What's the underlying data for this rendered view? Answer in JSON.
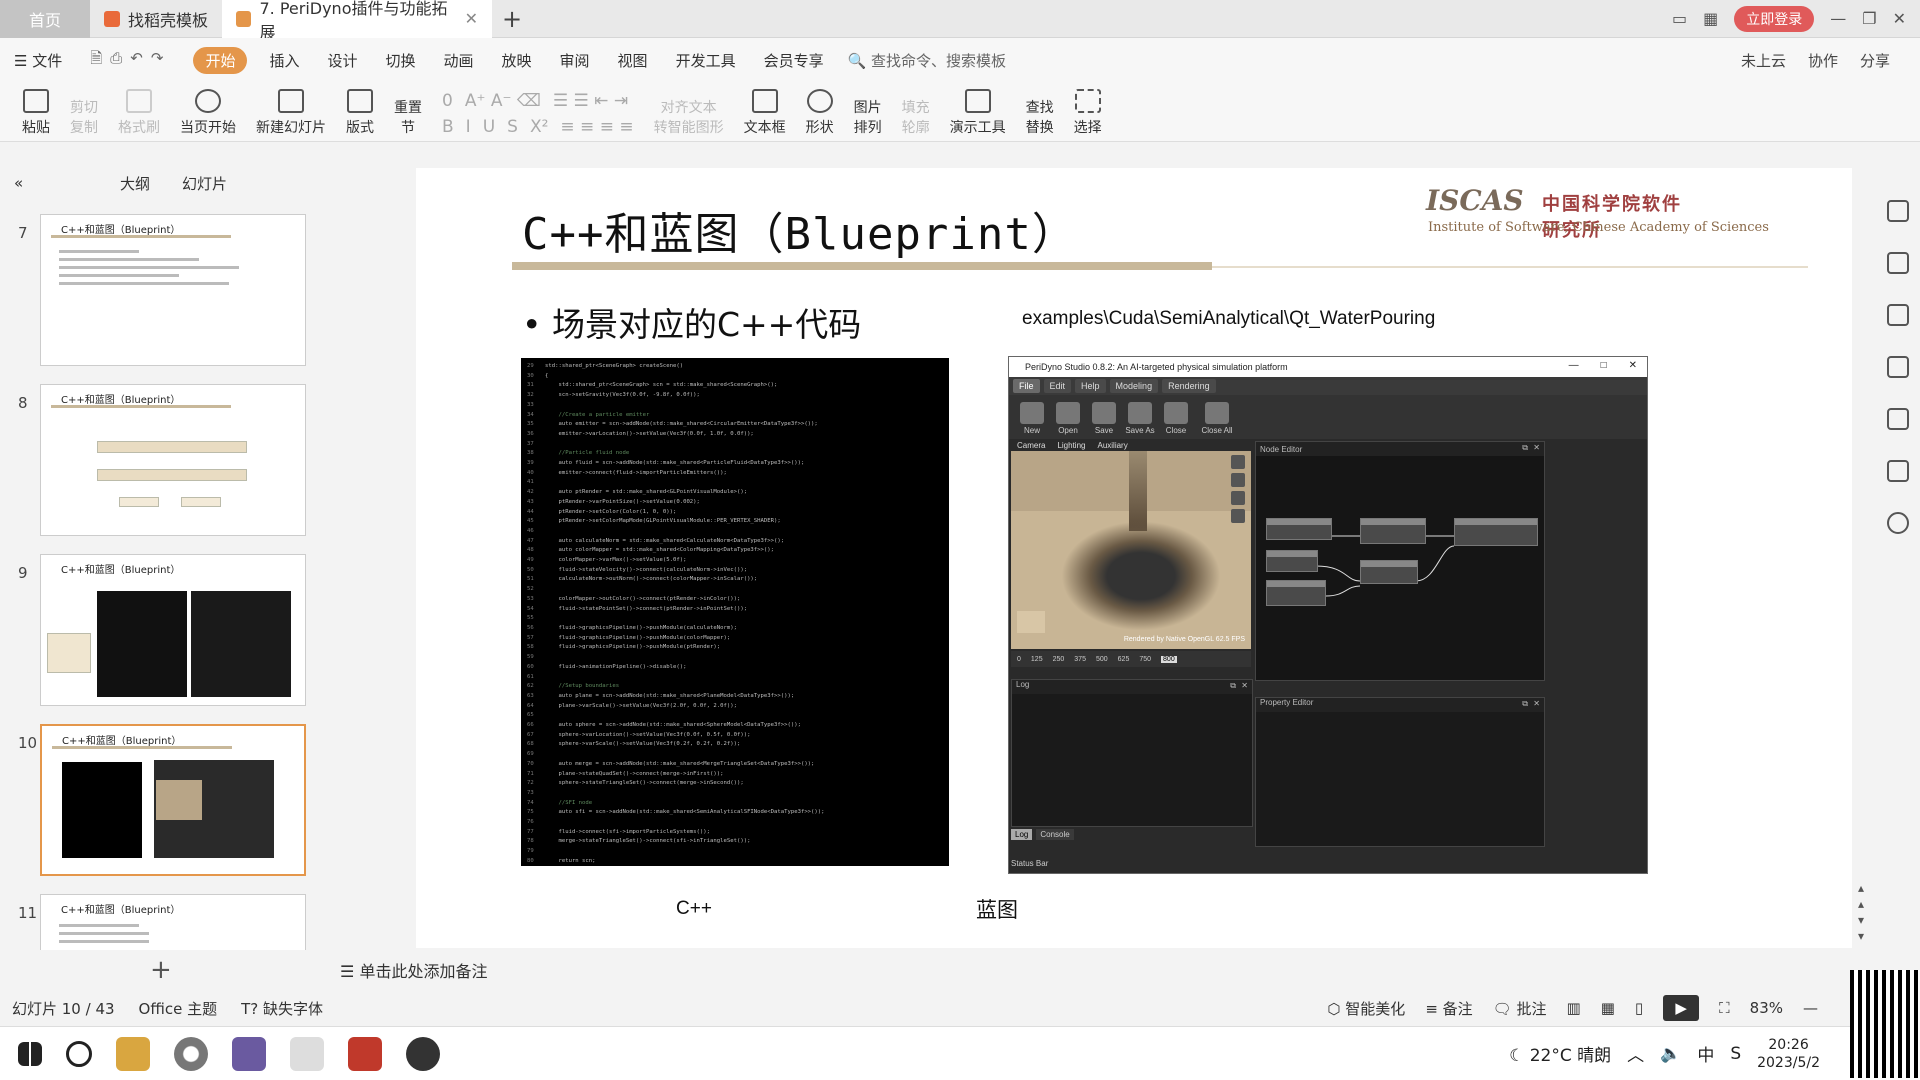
{
  "tabs": {
    "home": "首页",
    "template": "找稻壳模板",
    "doc": "7. PeriDyno插件与功能拓展",
    "login": "立即登录"
  },
  "menu": {
    "file": "文件",
    "items": [
      "开始",
      "插入",
      "设计",
      "切换",
      "动画",
      "放映",
      "审阅",
      "视图",
      "开发工具",
      "会员专享"
    ],
    "search": "查找命令、搜索模板",
    "right": [
      "未上云",
      "协作",
      "分享"
    ]
  },
  "ribbon": {
    "paste": "粘贴",
    "cut": "剪切",
    "copy": "复制",
    "format_painter": "格式刷",
    "play_from_current": "当页开始",
    "new_slide": "新建幻灯片",
    "layout": "版式",
    "section": "节",
    "reset": "重置",
    "font_size": "0",
    "text_align": "对齐文本",
    "smartart": "转智能图形",
    "textbox": "文本框",
    "shape": "形状",
    "arrange": "排列",
    "picture": "图片",
    "fill": "填充",
    "outline": "轮廓",
    "presentation_tools": "演示工具",
    "find": "查找",
    "replace": "替换",
    "select": "选择"
  },
  "left_pane": {
    "outline_tab": "大纲",
    "slides_tab": "幻灯片",
    "thumbs": [
      {
        "num": "7",
        "title": "C++和蓝图（Blueprint）"
      },
      {
        "num": "8",
        "title": "C++和蓝图（Blueprint）"
      },
      {
        "num": "9",
        "title": "C++和蓝图（Blueprint）"
      },
      {
        "num": "10",
        "title": "C++和蓝图（Blueprint）"
      },
      {
        "num": "11",
        "title": "C++和蓝图（Blueprint）"
      }
    ]
  },
  "notes_placeholder": "单击此处添加备注",
  "status": {
    "slide_pos": "幻灯片 10 / 43",
    "theme": "Office 主题",
    "missing_font": "缺失字体",
    "beautify": "智能美化",
    "notes": "备注",
    "comments": "批注",
    "zoom": "83%"
  },
  "taskbar": {
    "weather": "22°C 晴朗",
    "ime": "中",
    "time": "20:26",
    "date": "2023/5/2"
  },
  "slide": {
    "title": "C++和蓝图（Blueprint）",
    "logo_main": "ISCAS",
    "logo_cn": "中国科学院软件研究所",
    "logo_en": "Institute of Software, Chinese Academy of Sciences",
    "bullet": "场景对应的C++代码",
    "path": "examples\\Cuda\\SemiAnalytical\\Qt_WaterPouring",
    "caption_cpp": "C++",
    "caption_bp": "蓝图",
    "code_lines": [
      {
        "n": "29",
        "t": "std::shared_ptr<SceneGraph> createScene()"
      },
      {
        "n": "30",
        "t": "{"
      },
      {
        "n": "31",
        "t": "    std::shared_ptr<SceneGraph> scn = std::make_shared<SceneGraph>();"
      },
      {
        "n": "32",
        "t": "    scn->setGravity(Vec3f(0.0f, -9.8f, 0.0f));"
      },
      {
        "n": "33",
        "t": ""
      },
      {
        "n": "34",
        "t": "    //Create a particle emitter"
      },
      {
        "n": "35",
        "t": "    auto emitter = scn->addNode(std::make_shared<CircularEmitter<DataType3f>>());"
      },
      {
        "n": "36",
        "t": "    emitter->varLocation()->setValue(Vec3f(0.0f, 1.0f, 0.0f));"
      },
      {
        "n": "37",
        "t": ""
      },
      {
        "n": "38",
        "t": "    //Particle fluid node"
      },
      {
        "n": "39",
        "t": "    auto fluid = scn->addNode(std::make_shared<ParticleFluid<DataType3f>>());"
      },
      {
        "n": "40",
        "t": "    emitter->connect(fluid->importParticleEmitters());"
      },
      {
        "n": "41",
        "t": ""
      },
      {
        "n": "42",
        "t": "    auto ptRender = std::make_shared<GLPointVisualModule>();"
      },
      {
        "n": "43",
        "t": "    ptRender->varPointSize()->setValue(0.002);"
      },
      {
        "n": "44",
        "t": "    ptRender->setColor(Color(1, 0, 0));"
      },
      {
        "n": "45",
        "t": "    ptRender->setColorMapMode(GLPointVisualModule::PER_VERTEX_SHADER);"
      },
      {
        "n": "46",
        "t": ""
      },
      {
        "n": "47",
        "t": "    auto calculateNorm = std::make_shared<CalculateNorm<DataType3f>>();"
      },
      {
        "n": "48",
        "t": "    auto colorMapper = std::make_shared<ColorMapping<DataType3f>>();"
      },
      {
        "n": "49",
        "t": "    colorMapper->varMax()->setValue(5.0f);"
      },
      {
        "n": "50",
        "t": "    fluid->stateVelocity()->connect(calculateNorm->inVec());"
      },
      {
        "n": "51",
        "t": "    calculateNorm->outNorm()->connect(colorMapper->inScalar());"
      },
      {
        "n": "52",
        "t": ""
      },
      {
        "n": "53",
        "t": "    colorMapper->outColor()->connect(ptRender->inColor());"
      },
      {
        "n": "54",
        "t": "    fluid->statePointSet()->connect(ptRender->inPointSet());"
      },
      {
        "n": "55",
        "t": ""
      },
      {
        "n": "56",
        "t": "    fluid->graphicsPipeline()->pushModule(calculateNorm);"
      },
      {
        "n": "57",
        "t": "    fluid->graphicsPipeline()->pushModule(colorMapper);"
      },
      {
        "n": "58",
        "t": "    fluid->graphicsPipeline()->pushModule(ptRender);"
      },
      {
        "n": "59",
        "t": ""
      },
      {
        "n": "60",
        "t": "    fluid->animationPipeline()->disable();"
      },
      {
        "n": "61",
        "t": ""
      },
      {
        "n": "62",
        "t": "    //Setup boundaries"
      },
      {
        "n": "63",
        "t": "    auto plane = scn->addNode(std::make_shared<PlaneModel<DataType3f>>());"
      },
      {
        "n": "64",
        "t": "    plane->varScale()->setValue(Vec3f(2.0f, 0.0f, 2.0f));"
      },
      {
        "n": "65",
        "t": ""
      },
      {
        "n": "66",
        "t": "    auto sphere = scn->addNode(std::make_shared<SphereModel<DataType3f>>());"
      },
      {
        "n": "67",
        "t": "    sphere->varLocation()->setValue(Vec3f(0.0f, 0.5f, 0.0f));"
      },
      {
        "n": "68",
        "t": "    sphere->varScale()->setValue(Vec3f(0.2f, 0.2f, 0.2f));"
      },
      {
        "n": "69",
        "t": ""
      },
      {
        "n": "70",
        "t": "    auto merge = scn->addNode(std::make_shared<MergeTriangleSet<DataType3f>>());"
      },
      {
        "n": "71",
        "t": "    plane->stateQuadSet()->connect(merge->inFirst());"
      },
      {
        "n": "72",
        "t": "    sphere->stateTriangleSet()->connect(merge->inSecond());"
      },
      {
        "n": "73",
        "t": ""
      },
      {
        "n": "74",
        "t": "    //SFI node"
      },
      {
        "n": "75",
        "t": "    auto sfi = scn->addNode(std::make_shared<SemiAnalyticalSFINode<DataType3f>>());"
      },
      {
        "n": "76",
        "t": ""
      },
      {
        "n": "77",
        "t": "    fluid->connect(sfi->importParticleSystems());"
      },
      {
        "n": "78",
        "t": "    merge->stateTriangleSet()->connect(sfi->inTriangleSet());"
      },
      {
        "n": "79",
        "t": ""
      },
      {
        "n": "80",
        "t": "    return scn;"
      }
    ]
  },
  "peridyno": {
    "title": "PeriDyno Studio 0.8.2:  An AI-targeted physical simulation platform",
    "menu": [
      "File",
      "Edit",
      "Help",
      "Modeling",
      "Rendering"
    ],
    "tools": [
      "New",
      "Open",
      "Save",
      "Save As",
      "Close",
      "Close All"
    ],
    "view_tabs": [
      "Camera",
      "Lighting",
      "Auxiliary"
    ],
    "render_label": "Rendered by Native OpenGL  62.5 FPS",
    "timeline": [
      "0",
      "125",
      "250",
      "375",
      "500",
      "625",
      "750",
      "800"
    ],
    "node_editor": "Node Editor",
    "log": "Log",
    "log_tabs": [
      "Log",
      "Console"
    ],
    "property_editor": "Property Editor",
    "status_bar": "Status Bar"
  }
}
